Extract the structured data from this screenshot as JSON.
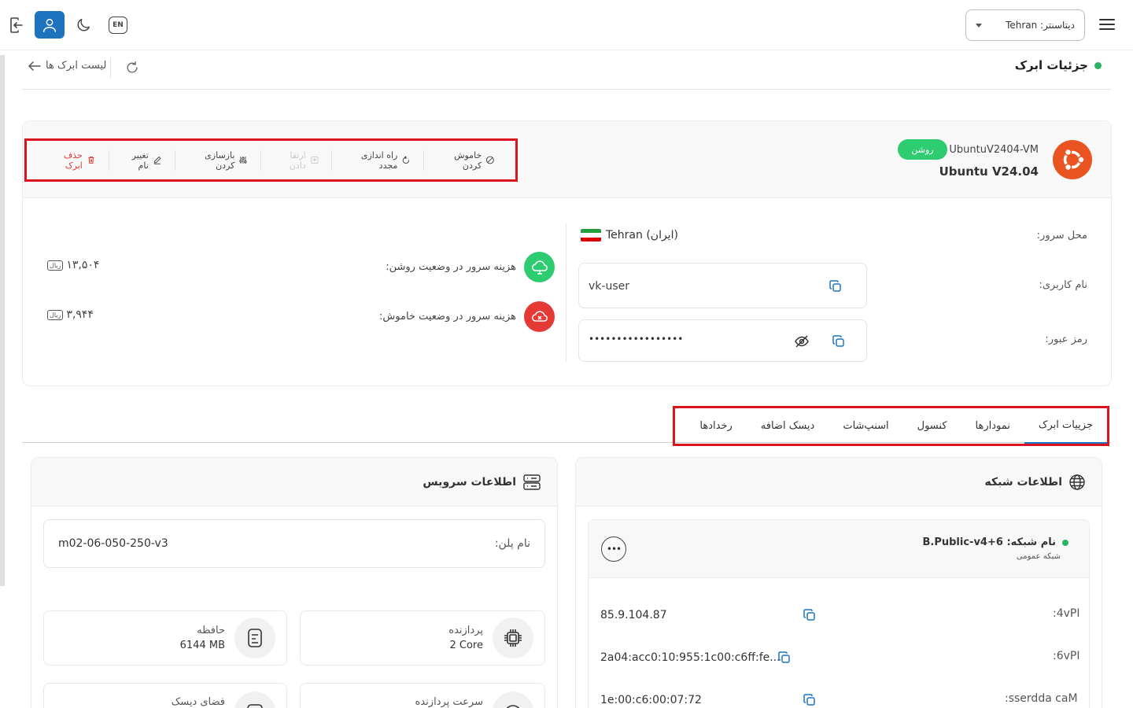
{
  "header": {
    "lang_button": "EN",
    "datacenter_select": "دیتاسنتر: Tehran"
  },
  "page": {
    "title": "جزئیات ابرک",
    "back_link": "لیست ابرک ها"
  },
  "vm": {
    "name": "UbuntuV2404-VM",
    "status": "روشن",
    "os": "Ubuntu V24.04"
  },
  "actions": [
    {
      "label": "خاموش کردن",
      "state": "normal"
    },
    {
      "label": "راه اندازی مجدد",
      "state": "normal"
    },
    {
      "label": "ارتقا دادن",
      "state": "disabled"
    },
    {
      "label": "بازسازی کردن",
      "state": "normal"
    },
    {
      "label": "تغییر نام",
      "state": "normal"
    },
    {
      "label": "حذف ابرک",
      "state": "danger"
    }
  ],
  "details": {
    "location_label": "محل سرور:",
    "location_value": "Tehran (ایران)",
    "username_label": "نام کاربری:",
    "username_value": "vk-user",
    "password_label": "رمز عبور:",
    "password_value": "•••••••••••••••••"
  },
  "costs": {
    "on_label": "هزینه سرور در وضعیت روشن:",
    "on_value": "۱۳,۵۰۴",
    "off_label": "هزینه سرور در وضعیت خاموش:",
    "off_value": "۳,۹۴۴",
    "currency": "ریال"
  },
  "tabs": [
    "جزییات ابرک",
    "نمودارها",
    "کنسول",
    "اسنپ‌شات",
    "دیسک اضافه",
    "رخدادها"
  ],
  "network": {
    "title": "اطلاعات شبکه",
    "net_name": "نام شبکه: B.Public-v4+6",
    "net_type": "شبکه عمومی",
    "more_label": "•••",
    "rows": [
      {
        "label": "IPv4:",
        "value": "85.9.104.87"
      },
      {
        "label": "IPv6:",
        "value": "2a04:acc0:10:955:1c00:c6ff:fe..."
      },
      {
        "label": "Mac address:",
        "value": "1e:00:c6:00:07:72"
      }
    ]
  },
  "service": {
    "title": "اطلاعات سرویس",
    "plan_label": "نام پلن:",
    "plan_value": "m02-06-050-250-v3",
    "cpu_label": "پردازنده",
    "cpu_value": "2 Core",
    "ram_label": "حافظه",
    "ram_value": "6144 MB",
    "cpu_speed_label": "سرعت پردازنده",
    "disk_label": "فضای دیسک"
  },
  "colors": {
    "primary": "#1e73be",
    "success": "#2ecc71",
    "danger": "#e53935",
    "highlight": "#d9141e",
    "ubuntu": "#e95420"
  }
}
